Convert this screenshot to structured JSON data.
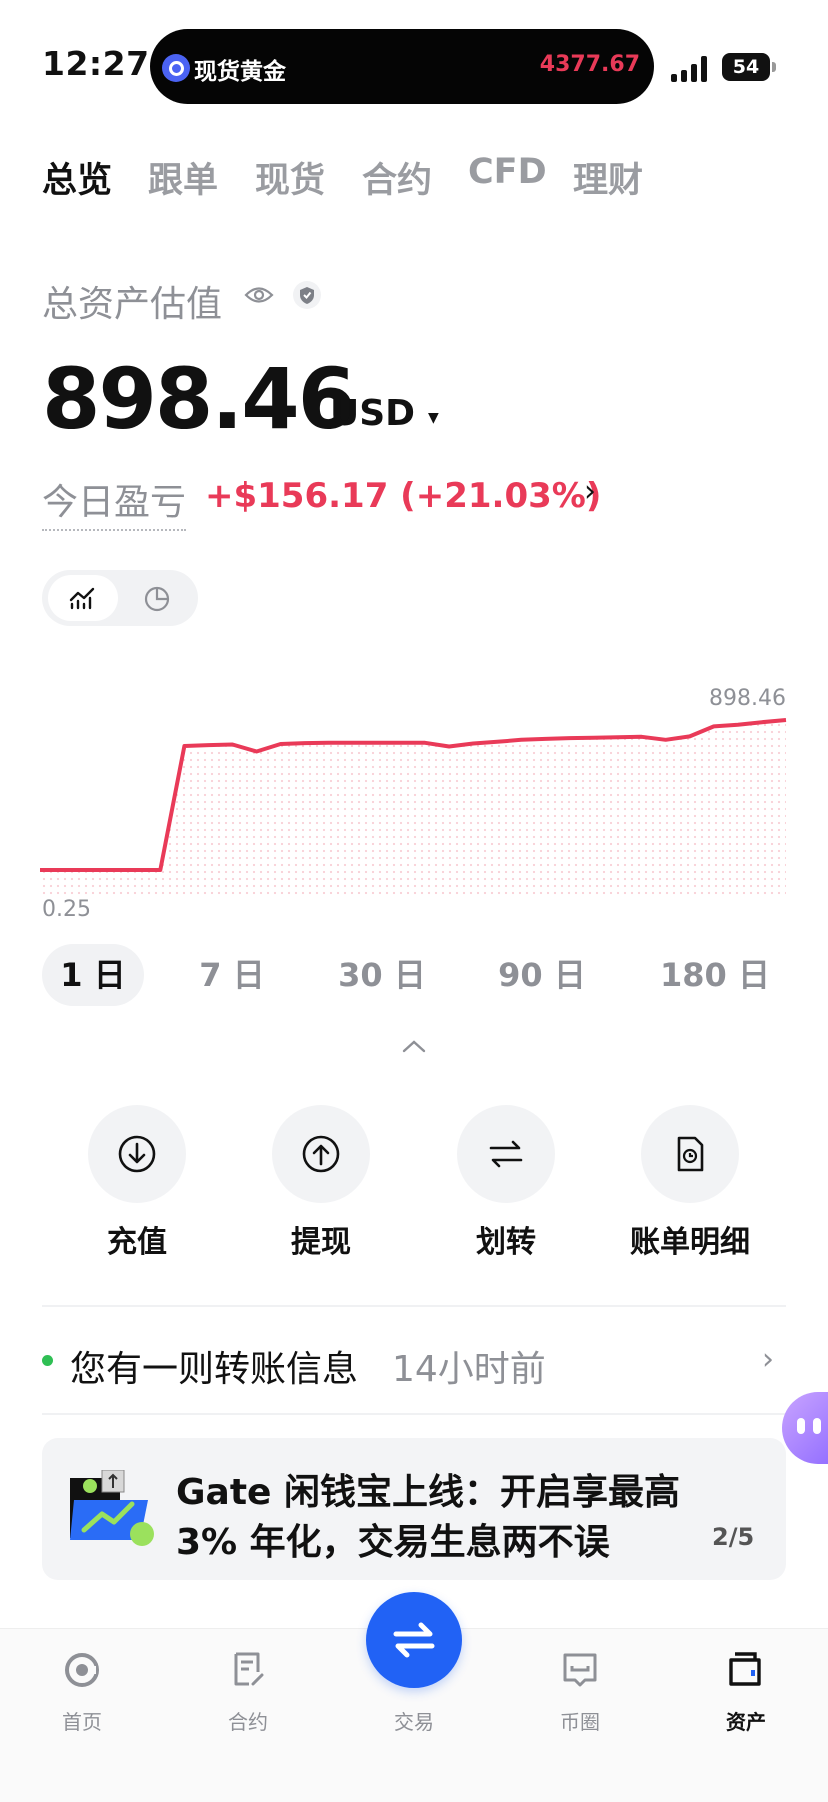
{
  "status_bar": {
    "time": "12:27",
    "island_label": "现货黄金",
    "island_price": "4377.67",
    "battery": "54"
  },
  "tabs": [
    {
      "label": "总览",
      "active": true
    },
    {
      "label": "跟单",
      "active": false
    },
    {
      "label": "现货",
      "active": false
    },
    {
      "label": "合约",
      "active": false
    },
    {
      "label": "CFD",
      "active": false
    },
    {
      "label": "理财",
      "active": false
    }
  ],
  "assets": {
    "label": "总资产估值",
    "balance": "898.46",
    "currency": "USD",
    "pnl_label": "今日盈亏",
    "pnl_value": "+$156.17 (+21.03%)"
  },
  "chart_data": {
    "type": "area",
    "x": [
      "00:00",
      "01:00",
      "02:00",
      "03:00",
      "04:00",
      "05:00",
      "05:05",
      "06:00",
      "07:00",
      "07:30",
      "07:45",
      "08:00",
      "09:00",
      "10:00",
      "11:00",
      "12:00",
      "13:00",
      "13:30",
      "13:45",
      "14:00",
      "15:00",
      "16:00",
      "17:00",
      "18:00",
      "19:00",
      "20:00",
      "20:30",
      "20:45",
      "21:00",
      "22:00",
      "23:00",
      "24:00"
    ],
    "values": [
      0.25,
      0.25,
      0.25,
      0.25,
      0.25,
      0.25,
      743,
      748,
      752,
      710,
      755,
      760,
      762,
      762,
      762,
      762,
      762,
      740,
      758,
      768,
      780,
      785,
      790,
      792,
      795,
      798,
      780,
      800,
      860,
      870,
      885,
      898.46
    ],
    "max_label": "898.46",
    "min_label": "0.25",
    "color": "#e93a58"
  },
  "periods": [
    {
      "label": "1 日",
      "active": true
    },
    {
      "label": "7 日",
      "active": false
    },
    {
      "label": "30 日",
      "active": false
    },
    {
      "label": "90 日",
      "active": false
    },
    {
      "label": "180 日",
      "active": false
    }
  ],
  "actions": [
    {
      "label": "充值",
      "icon": "deposit-icon"
    },
    {
      "label": "提现",
      "icon": "withdraw-icon"
    },
    {
      "label": "划转",
      "icon": "transfer-icon"
    },
    {
      "label": "账单明细",
      "icon": "bill-icon"
    }
  ],
  "notification": {
    "text": "您有一则转账信息",
    "time": "14小时前"
  },
  "banner": {
    "line1": "Gate 闲钱宝上线：开启享最高",
    "line2": "3% 年化，交易生息两不误",
    "page": "2/5"
  },
  "bottom_nav": [
    {
      "label": "首页",
      "icon": "home-icon",
      "active": false
    },
    {
      "label": "合约",
      "icon": "futures-icon",
      "active": false
    },
    {
      "label": "交易",
      "icon": "trade-icon",
      "active": false
    },
    {
      "label": "币圈",
      "icon": "community-icon",
      "active": false
    },
    {
      "label": "资产",
      "icon": "wallet-icon",
      "active": true
    }
  ],
  "colors": {
    "accent": "#2162f5",
    "loss_gain": "#e93a58",
    "notification_dot": "#2fbf54"
  }
}
